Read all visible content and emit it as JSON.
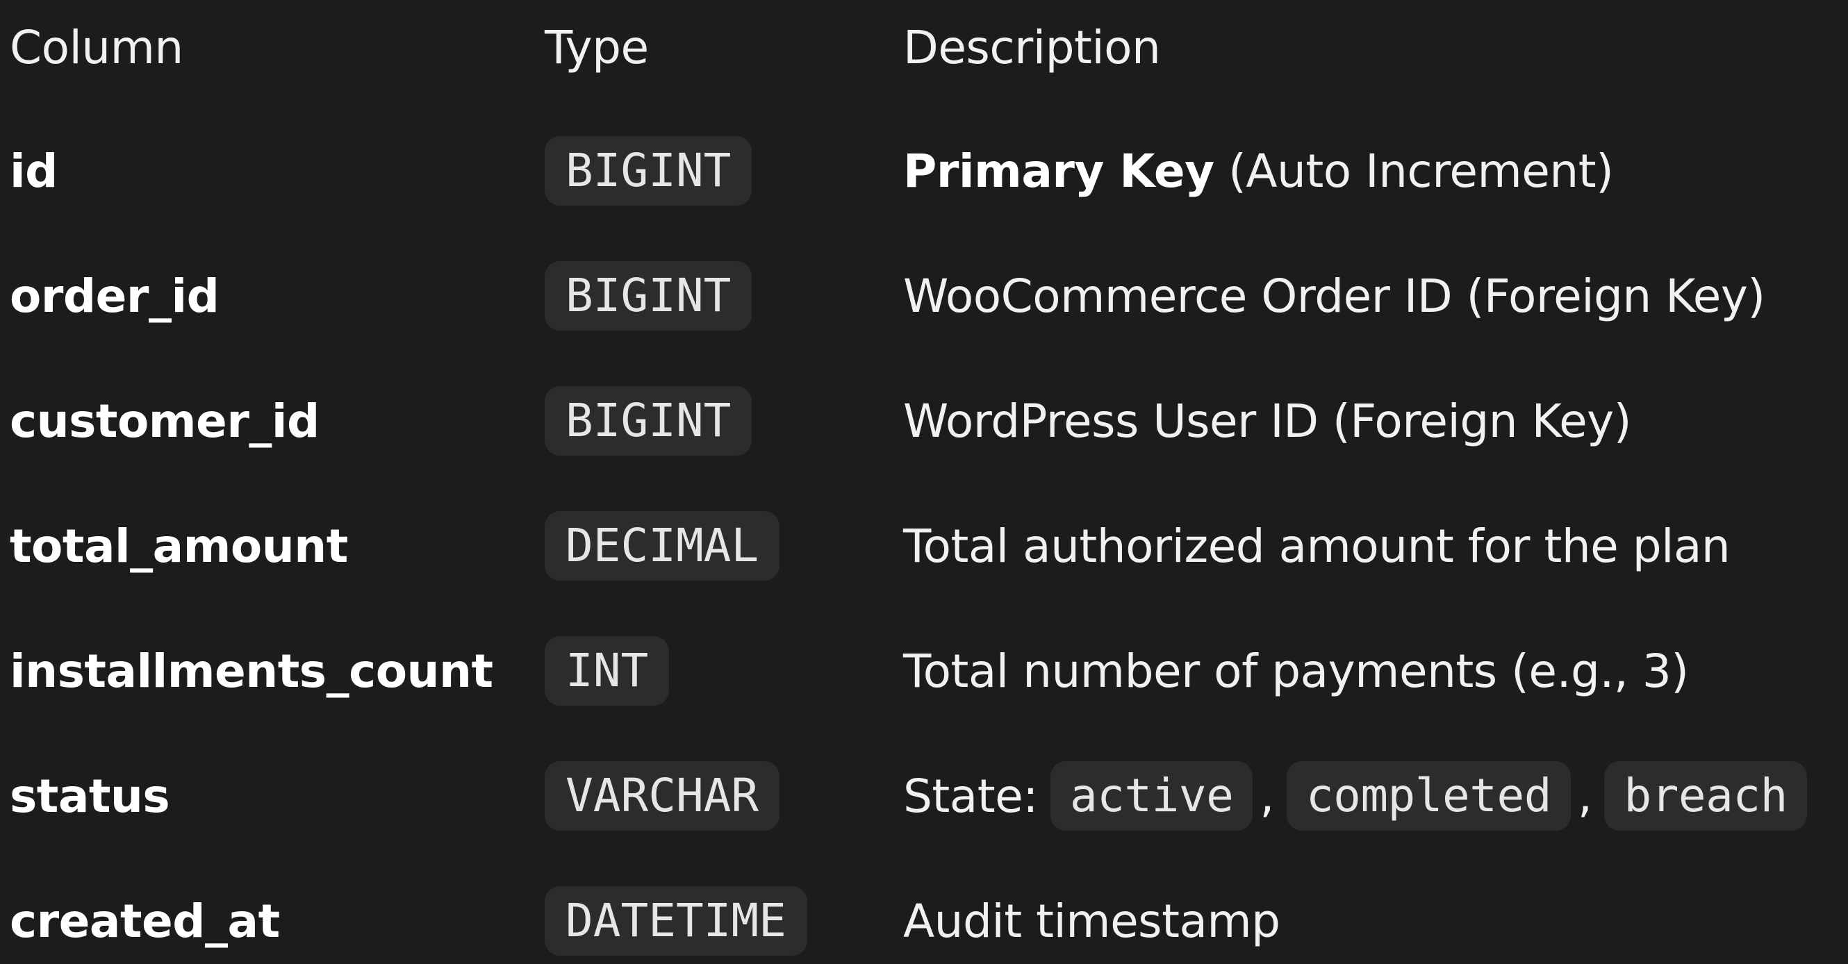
{
  "header": {
    "column": "Column",
    "type": "Type",
    "description": "Description"
  },
  "rows": [
    {
      "column": "id",
      "type": "BIGINT",
      "desc_strong": "Primary Key",
      "desc": "(Auto Increment)"
    },
    {
      "column": "order_id",
      "type": "BIGINT",
      "desc": "WooCommerce Order ID (Foreign Key)"
    },
    {
      "column": "customer_id",
      "type": "BIGINT",
      "desc": "WordPress User ID (Foreign Key)"
    },
    {
      "column": "total_amount",
      "type": "DECIMAL",
      "desc": "Total authorized amount for the plan"
    },
    {
      "column": "installments_count",
      "type": "INT",
      "desc": "Total number of payments (e.g., 3)"
    },
    {
      "column": "status",
      "type": "VARCHAR",
      "desc": "State:",
      "states": [
        "active",
        "completed",
        "breach"
      ],
      "separator": ","
    },
    {
      "column": "created_at",
      "type": "DATETIME",
      "desc": "Audit timestamp"
    }
  ]
}
